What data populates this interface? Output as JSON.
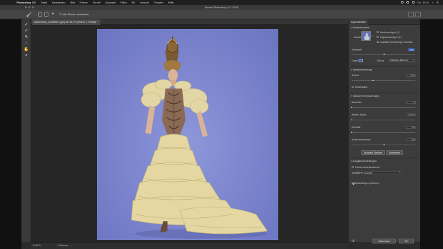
{
  "menubar": {
    "app_name": "Photoshop CC",
    "items": [
      "Datei",
      "Bearbeiten",
      "Bild",
      "Ebene",
      "Schrift",
      "Auswahl",
      "Filter",
      "3D",
      "Ansicht",
      "Fenster",
      "Hilfe"
    ],
    "clock": "Do. 10:11"
  },
  "window": {
    "title": "Adobe Photoshop CC 2018"
  },
  "options_bar": {
    "sample_all_layers_label": "Alle Ebenen aufnehmen"
  },
  "document": {
    "tab_label": "Adobestock_111559517.jpeg bei 15,7% (Ebene 1, RGB/8) *"
  },
  "status_bar": {
    "zoom": "15,67%",
    "info": "1 Ebenen"
  },
  "panel": {
    "tab": "Eigenschaften",
    "view_mode": {
      "header": "Ansichtsmodus",
      "view_label": "Ansicht:",
      "options": [
        "Kante anzeigen (J)",
        "Original anzeigen (P)",
        "Qualitativ hochwertige Vorschau"
      ],
      "selected": [
        false,
        false,
        true
      ]
    },
    "opacity": {
      "label": "Deckkraft:",
      "value": "100",
      "level": 0.5
    },
    "color": {
      "label": "Farbe:",
      "value": "25% an",
      "mode": "Maskierte Bereiche",
      "swatch": "#2f56c9"
    },
    "edge_detection": {
      "header": "Kantenerkennung",
      "radius_label": "Radius:",
      "radius_value": "0 Px",
      "radius_level": 0.02,
      "smart_radius_label": "Smartradius",
      "smart_radius_checked": false
    },
    "global_refinements": {
      "header": "Globale Verbesserungen",
      "smooth_label": "Abrunden:",
      "smooth_value": "0",
      "smooth_level": 0.0,
      "feather_label": "Weiche Kante:",
      "feather_value": "0,0 Px",
      "feather_level": 0.0,
      "contrast_label": "Kontrast:",
      "contrast_value": "0%",
      "contrast_level": 0.0,
      "shift_label": "Kante verschieben:",
      "shift_value": "+1%",
      "shift_level": 0.51,
      "clear_selection_button": "Auswahl löschen",
      "invert_button": "Umkehren"
    },
    "output": {
      "header": "Ausgabeeinstellungen",
      "decontaminate_label": "Farben dekontaminieren",
      "decontaminate_checked": false,
      "output_to_label": "Ausgabe in:",
      "output_to_value": "Auswahl",
      "remember_label": "Einstellungen speichern",
      "remember_checked": true
    },
    "cancel_button": "Abbrechen",
    "ok_button": "OK"
  },
  "icons": {
    "tools": [
      "quick-selection-icon",
      "refine-edge-brush-icon",
      "brush-icon",
      "lasso-icon",
      "hand-icon",
      "zoom-icon"
    ]
  }
}
